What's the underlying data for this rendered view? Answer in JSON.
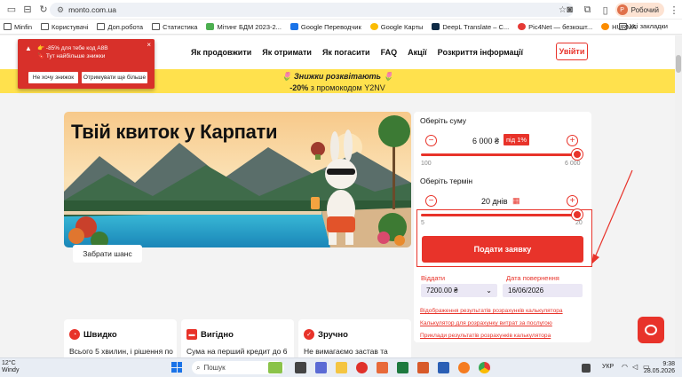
{
  "browser": {
    "url": "monto.com.ua",
    "profile_initial": "Р",
    "profile_label": "Робочий",
    "bookmarks": [
      {
        "label": "Minfin",
        "icon": "folder-icon"
      },
      {
        "label": "Користувачі",
        "icon": "folder-icon"
      },
      {
        "label": "Доп.робота",
        "icon": "folder-icon"
      },
      {
        "label": "Статистика",
        "icon": "folder-icon"
      },
      {
        "label": "Мітинг БДМ 2023-2...",
        "icon": "sheets-icon"
      },
      {
        "label": "Google Переводчик",
        "icon": "translate-icon"
      },
      {
        "label": "Google Карты",
        "icon": "maps-icon"
      },
      {
        "label": "DeepL Translate – C...",
        "icon": "deepl-icon"
      },
      {
        "label": "Pic4Net — безкошт...",
        "icon": "pic-icon"
      },
      {
        "label": "HURMA",
        "icon": "hurma-icon"
      }
    ],
    "all_bookmarks": "Усі закладки"
  },
  "popup": {
    "line1": "👉 -85% для тебе код A8B",
    "line2": "🔖 Тут найбільше знижки",
    "decline": "Не хочу знижок",
    "accept": "Отримувати ще більше"
  },
  "nav": {
    "items": [
      "Як продовжити",
      "Як отримати",
      "Як погасити",
      "FAQ",
      "Акції",
      "Розкриття інформації"
    ],
    "login": "Увійти"
  },
  "banner": {
    "line1": "🌷 Знижки розквітають 🌷",
    "promo_prefix": "-20%",
    "promo_rest": " з промокодом Y2NV"
  },
  "hero": {
    "title": "Твій квиток у Карпати",
    "button": "Забрати шанс"
  },
  "calculator": {
    "amount_label": "Оберіть суму",
    "amount_value": "6 000 ₴",
    "amount_tag": "під 1%",
    "amount_min": "100",
    "amount_max": "6 000",
    "amount_level": 1.0,
    "term_label": "Оберіть термін",
    "term_value": "20 днів",
    "term_min": "5",
    "term_max": "20",
    "term_level": 1.0,
    "submit": "Подати заявку",
    "given_label": "Віддати",
    "given_value": "7200.00 ₴",
    "return_label": "Дата повернення",
    "return_value": "16/06/2026",
    "links": [
      "Відображення результатів розрахунків калькулятора",
      "Калькулятор для розрахунку витрат за послугою",
      "Приклади результатів розрахунків калькулятора"
    ]
  },
  "features": [
    {
      "title": "Швидко",
      "text": "Всього 5 хвилин, і рішення по заявці готове.",
      "icon": "clock-icon"
    },
    {
      "title": "Вигідно",
      "text": "Сума на перший кредит до 6 000 грн. до 20 днів під 1%.",
      "icon": "card-icon"
    },
    {
      "title": "Зручно",
      "text": "Не вимагаємо застав та поручителів.",
      "icon": "check-icon"
    }
  ],
  "taskbar": {
    "temp": "12°C",
    "weather": "Windy",
    "search": "Пошук",
    "lang": "УКР",
    "time": "9:38",
    "date": "28.05.2026"
  },
  "colors": {
    "accent": "#e8332a",
    "banner": "#ffe14d"
  }
}
